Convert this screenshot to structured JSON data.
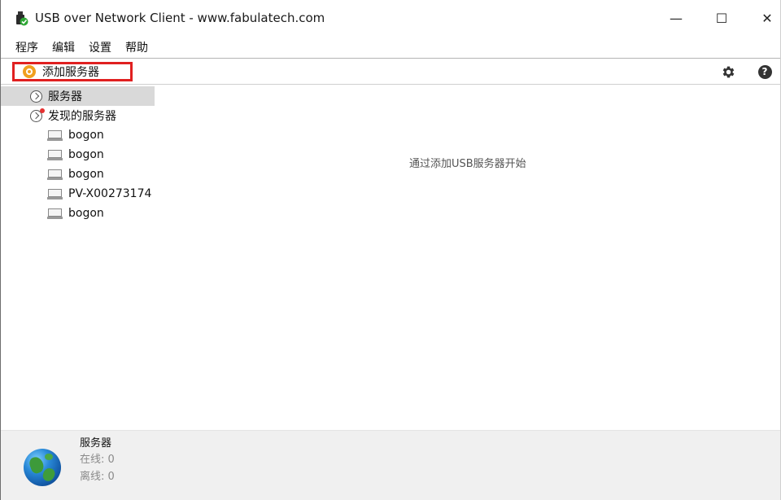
{
  "window": {
    "title": "USB over Network Client - www.fabulatech.com",
    "controls": {
      "minimize": "—",
      "maximize": "☐",
      "close": "✕"
    }
  },
  "menu": {
    "items": [
      {
        "label": "程序"
      },
      {
        "label": "编辑"
      },
      {
        "label": "设置"
      },
      {
        "label": "帮助"
      }
    ]
  },
  "toolbar": {
    "add_server_label": "添加服务器",
    "add_server_icon": "add-server-icon",
    "settings_icon": "gear-icon",
    "help_icon": "help-icon",
    "help_glyph": "?",
    "highlight_color": "#e02020"
  },
  "tree": {
    "root_label": "服务器",
    "discovered_label": "发现的服务器",
    "hosts": [
      {
        "label": "bogon"
      },
      {
        "label": "bogon"
      },
      {
        "label": "bogon"
      },
      {
        "label": "PV-X00273174"
      },
      {
        "label": "bogon"
      }
    ]
  },
  "main": {
    "hint": "通过添加USB服务器开始"
  },
  "status": {
    "title": "服务器",
    "online": "在线: 0",
    "offline": "离线: 0"
  }
}
